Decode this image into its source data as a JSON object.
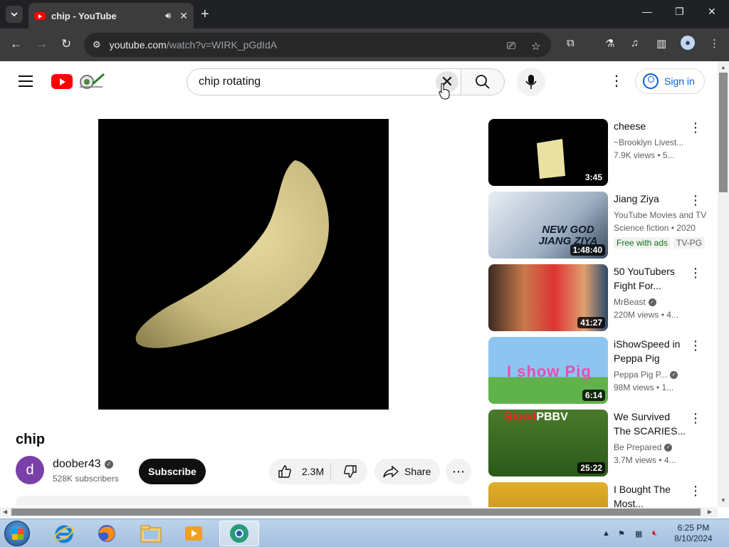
{
  "browser": {
    "tab_title": "chip - YouTube",
    "url_host": "youtube.com",
    "url_path": "/watch?v=WIRK_pGdIdA"
  },
  "header": {
    "search_value": "chip rotating",
    "sign_in": "Sign in"
  },
  "video": {
    "title": "chip",
    "channel": "doober43",
    "channel_initial": "d",
    "subscribers": "528K subscribers",
    "subscribe_label": "Subscribe",
    "likes": "2.3M",
    "share_label": "Share"
  },
  "recommendations": [
    {
      "title": "cheese",
      "channel": "~Brooklyn Livest...",
      "meta": "7.9K views • 5...",
      "duration": "3:45"
    },
    {
      "title": "Jiang Ziya",
      "channel": "YouTube Movies and TV",
      "meta": "Science fiction • 2020",
      "duration": "1:48:40",
      "badge1": "Free with ads",
      "badge2": "TV-PG",
      "thumb_text1": "NEW GOD",
      "thumb_text2": "JIANG ZIYA"
    },
    {
      "title": "50 YouTubers Fight For...",
      "channel": "MrBeast",
      "meta": "220M views • 4...",
      "duration": "41:27"
    },
    {
      "title": "iShowSpeed in Peppa Pig",
      "channel": "Peppa Pig P...",
      "meta": "98M views • 1...",
      "duration": "6:14",
      "thumb_text1": "I show Pig"
    },
    {
      "title": "We Survived The SCARIES...",
      "channel": "Be Prepared",
      "meta": "3.7M views • 4...",
      "duration": "25:22",
      "thumb_text1": "Blood",
      "thumb_text2": "PBBV"
    },
    {
      "title": "I Bought The Most...",
      "channel": "",
      "meta": "",
      "duration": ""
    }
  ],
  "taskbar": {
    "time": "6:25 PM",
    "date": "8/10/2024"
  },
  "colors": {
    "youtube_red": "#ff0000",
    "link_blue": "#065fd4",
    "chrome_dark": "#202124"
  }
}
